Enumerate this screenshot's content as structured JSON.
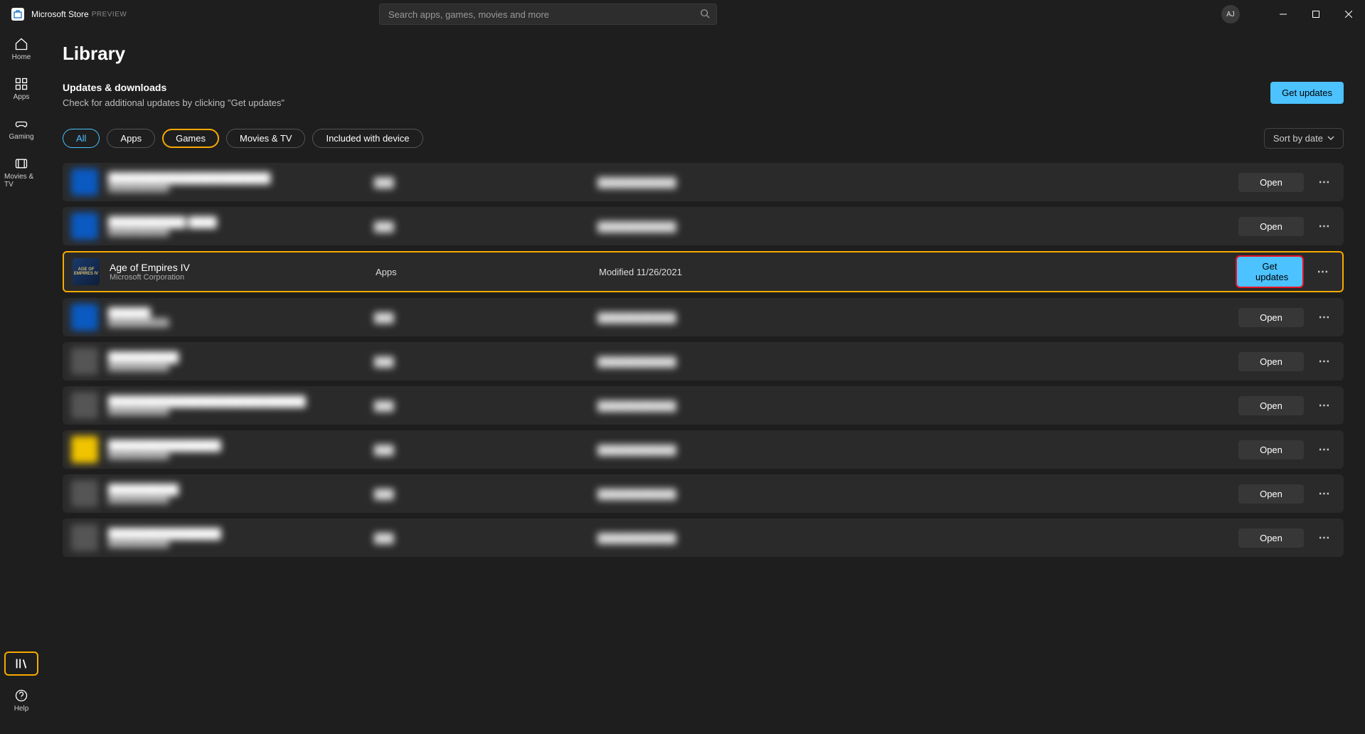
{
  "titlebar": {
    "app_name": "Microsoft Store",
    "preview_label": "PREVIEW",
    "search_placeholder": "Search apps, games, movies and more",
    "avatar_initials": "AJ"
  },
  "nav": {
    "home": "Home",
    "apps": "Apps",
    "gaming": "Gaming",
    "movies": "Movies & TV",
    "library": "Library",
    "help": "Help"
  },
  "page": {
    "title": "Library",
    "sub_title": "Updates & downloads",
    "sub_desc": "Check for additional updates by clicking \"Get updates\"",
    "get_updates": "Get updates",
    "sort_label": "Sort by date"
  },
  "filters": {
    "all": "All",
    "apps": "Apps",
    "games": "Games",
    "movies": "Movies & TV",
    "included": "Included with device"
  },
  "buttons": {
    "open": "Open",
    "get_updates": "Get updates"
  },
  "rows": [
    {
      "blurred": true,
      "thumb": "thumb-blue",
      "name": "███████████████████████",
      "pub": "███████████",
      "cat": "███",
      "mod": "████████████",
      "action": "open"
    },
    {
      "blurred": true,
      "thumb": "thumb-blue",
      "name": "███████████ ████",
      "pub": "███████████",
      "cat": "███",
      "mod": "████████████",
      "action": "open"
    },
    {
      "blurred": false,
      "highlighted": true,
      "thumb": "thumb-aoe",
      "name": "Age of Empires IV",
      "pub": "Microsoft Corporation",
      "cat": "Apps",
      "mod": "Modified 11/26/2021",
      "action": "get_updates",
      "red_outline": true
    },
    {
      "blurred": true,
      "thumb": "thumb-blue",
      "name": "██████",
      "pub": "███████████",
      "cat": "███",
      "mod": "████████████",
      "action": "open"
    },
    {
      "blurred": true,
      "thumb": "thumb-grey",
      "name": "██████████",
      "pub": "███████████",
      "cat": "███",
      "mod": "████████████",
      "action": "open"
    },
    {
      "blurred": true,
      "thumb": "thumb-grey",
      "name": "████████████████████████████",
      "pub": "███████████",
      "cat": "███",
      "mod": "████████████",
      "action": "open"
    },
    {
      "blurred": true,
      "thumb": "thumb-yellow",
      "name": "████████████████",
      "pub": "███████████",
      "cat": "███",
      "mod": "████████████",
      "action": "open"
    },
    {
      "blurred": true,
      "thumb": "thumb-grey",
      "name": "██████████",
      "pub": "███████████",
      "cat": "███",
      "mod": "████████████",
      "action": "open"
    },
    {
      "blurred": true,
      "thumb": "thumb-grey",
      "name": "████████████████",
      "pub": "███████████",
      "cat": "███",
      "mod": "████████████",
      "action": "open"
    }
  ]
}
